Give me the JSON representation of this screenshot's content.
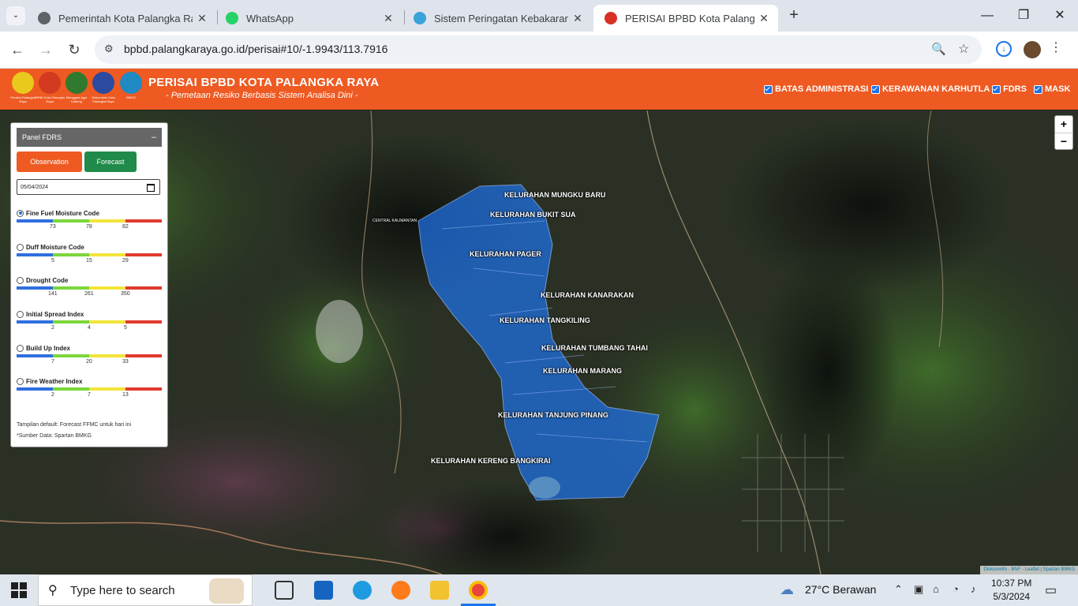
{
  "browser": {
    "tabs": [
      {
        "title": "Pemerintah Kota Palangka Raya",
        "active": false,
        "icon": "globe-icon"
      },
      {
        "title": "WhatsApp",
        "active": false,
        "icon": "whatsapp-icon"
      },
      {
        "title": "Sistem Peringatan Kebakaran H",
        "active": false,
        "icon": "bmkg-icon"
      },
      {
        "title": "PERISAI BPBD Kota Palangka Ra",
        "active": true,
        "icon": "bpbd-icon"
      }
    ],
    "url": "bpbd.palangkaraya.go.id/perisai#10/-1.9943/113.7916"
  },
  "site": {
    "title": "PERISAI BPBD KOTA PALANGKA RAYA",
    "subtitle": "- Pemetaan Resiko Berbasis Sistem Analisa Dini -",
    "logos": [
      {
        "caption": "Pemkot Palangka Raya",
        "color": "#e8c91c"
      },
      {
        "caption": "BPBD Kota Palangka Raya",
        "color": "#d43a1f"
      },
      {
        "caption": "Manggala Agni Kalteng",
        "color": "#2f7a2f"
      },
      {
        "caption": "Diskominfo Kota Palangka Raya",
        "color": "#2b4aa0"
      },
      {
        "caption": "BMKG",
        "color": "#1f8ac4"
      }
    ],
    "layers": [
      "BATAS ADMINISTRASI",
      "KERAWANAN KARHUTLA",
      "FDRS",
      "MASK"
    ]
  },
  "panel": {
    "title": "Panel FDRS",
    "minimize": "–",
    "observation_label": "Observation",
    "forecast_label": "Forecast",
    "date": "05/04/2024",
    "indices": [
      {
        "name": "Fine Fuel Moisture Code",
        "selected": true,
        "thresholds": [
          "73",
          "78",
          "82"
        ]
      },
      {
        "name": "Duff Moisture Code",
        "selected": false,
        "thresholds": [
          "5",
          "15",
          "29"
        ]
      },
      {
        "name": "Drought Code",
        "selected": false,
        "thresholds": [
          "141",
          "261",
          "350"
        ]
      },
      {
        "name": "Initial Spread Index",
        "selected": false,
        "thresholds": [
          "2",
          "4",
          "5"
        ]
      },
      {
        "name": "Build Up Index",
        "selected": false,
        "thresholds": [
          "7",
          "20",
          "33"
        ]
      },
      {
        "name": "Fire Weather Index",
        "selected": false,
        "thresholds": [
          "2",
          "7",
          "13"
        ]
      }
    ],
    "scale_colors": [
      "#2f6fe0",
      "#7bd63a",
      "#f2e43a",
      "#e03a2f"
    ],
    "note_default": "Tampilan default: Forecast FFMC untuk hari ini",
    "note_source": "*Sumber Data: Spartan BMKG"
  },
  "map": {
    "kelurahan": [
      "KELURAHAN MUNGKU BARU",
      "KELURAHAN BUKIT SUA",
      "KELURAHAN PAGER",
      "KELURAHAN KANARAKAN",
      "KELURAHAN TANGKILING",
      "KELURAHAN TUMBANG TAHAI",
      "KELURAHAN MARANG",
      "KELURAHAN TANJUNG PINANG",
      "KELURAHAN KERENG BANGKIRAI"
    ],
    "place_labels": [
      "CENTRAL KALIMANTAN"
    ],
    "zoom_in": "+",
    "zoom_out": "−",
    "attribution": "Diskominfo - BNF - Leaflet | Spartan BMKG"
  },
  "taskbar": {
    "search_placeholder": "Type here to search",
    "weather": "27°C  Berawan",
    "time": "10:37 PM",
    "date": "5/3/2024"
  }
}
